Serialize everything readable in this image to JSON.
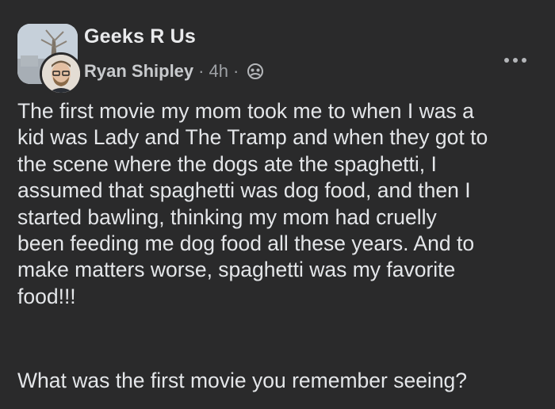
{
  "post": {
    "group_name": "Geeks R Us",
    "author": "Ryan Shipley",
    "separator": "·",
    "timestamp": "4h",
    "privacy_icon": "group-privacy-icon",
    "more_icon": "more-options-icon",
    "body": "The first movie my mom took me to when I was a\nkid was Lady and The Tramp and when they got to\nthe scene where the dogs ate the spaghetti, I\nassumed that spaghetti was dog food, and then I\nstarted bawling, thinking my mom had cruelly\nbeen feeding me dog food all these years. And to\nmake matters worse, spaghetti was my favorite\nfood!!!",
    "question": "What was the first movie you remember seeing?"
  },
  "colors": {
    "background": "#2a2a2b",
    "primary_text": "#e4e6e9",
    "secondary_text": "#9ea1a5"
  }
}
